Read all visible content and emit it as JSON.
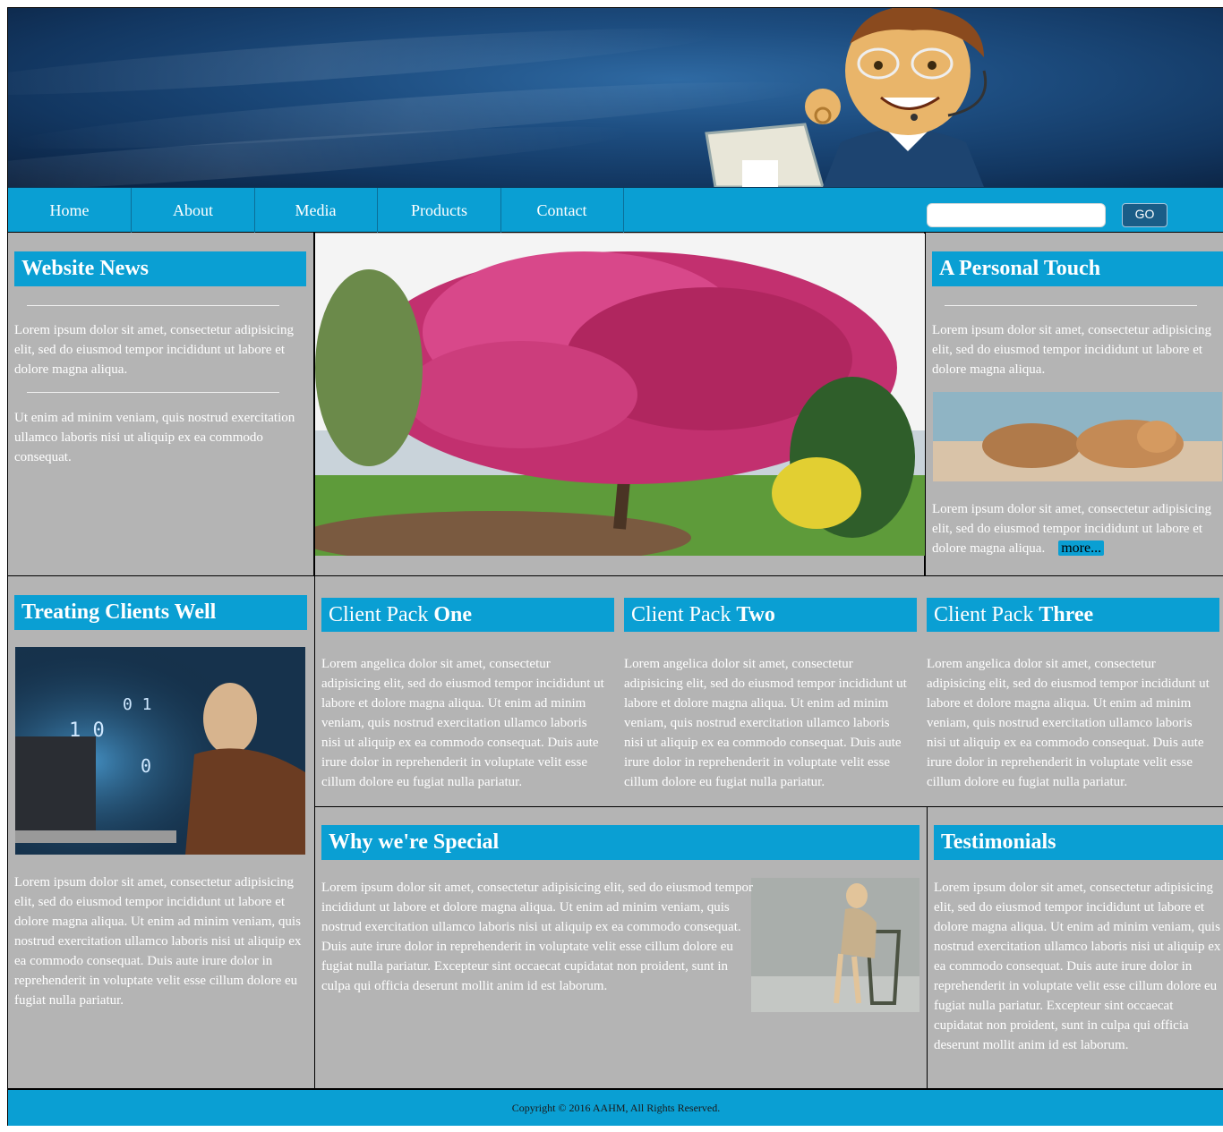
{
  "nav": {
    "items": [
      "Home",
      "About",
      "Media",
      "Products",
      "Contact"
    ],
    "search_placeholder": "",
    "go_label": "GO"
  },
  "website_news": {
    "title": "Website News",
    "para1": "Lorem ipsum dolor sit amet, consectetur adipisicing elit, sed do eiusmod tempor incididunt ut labore et dolore magna aliqua.",
    "para2": "Ut enim ad minim veniam, quis nostrud exercitation ullamco laboris nisi ut aliquip ex ea commodo consequat."
  },
  "personal_touch": {
    "title": "A Personal Touch",
    "para1": "Lorem ipsum dolor sit amet, consectetur adipisicing elit, sed do eiusmod tempor incididunt ut labore et dolore magna aliqua.",
    "para2": "Lorem ipsum dolor sit amet, consectetur adipisicing elit, sed do eiusmod tempor incididunt ut labore et dolore magna aliqua.",
    "more_label": "more..."
  },
  "treating_clients": {
    "title": "Treating Clients Well",
    "para": "Lorem ipsum dolor sit amet, consectetur adipisicing elit, sed do eiusmod tempor incididunt ut labore et dolore magna aliqua. Ut enim ad minim veniam, quis nostrud exercitation ullamco laboris nisi ut aliquip ex ea commodo consequat. Duis aute irure dolor in reprehenderit in voluptate velit esse cillum dolore eu fugiat nulla pariatur."
  },
  "packs": [
    {
      "prefix": "Client Pack ",
      "bold": "One",
      "text": "Lorem angelica dolor sit amet, consectetur adipisicing elit, sed do eiusmod tempor incididunt ut labore et dolore magna aliqua. Ut enim ad minim veniam, quis nostrud exercitation ullamco laboris nisi ut aliquip ex ea commodo consequat. Duis aute irure dolor in reprehenderit in voluptate velit esse cillum dolore eu fugiat nulla pariatur."
    },
    {
      "prefix": "Client Pack ",
      "bold": "Two",
      "text": "Lorem angelica dolor sit amet, consectetur adipisicing elit, sed do eiusmod tempor incididunt ut labore et dolore magna aliqua. Ut enim ad minim veniam, quis nostrud exercitation ullamco laboris nisi ut aliquip ex ea commodo consequat. Duis aute irure dolor in reprehenderit in voluptate velit esse cillum dolore eu fugiat nulla pariatur."
    },
    {
      "prefix": "Client Pack ",
      "bold": "Three",
      "text": "Lorem angelica dolor sit amet, consectetur adipisicing elit, sed do eiusmod tempor incididunt ut labore et dolore magna aliqua. Ut enim ad minim veniam, quis nostrud exercitation ullamco laboris nisi ut aliquip ex ea commodo consequat. Duis aute irure dolor in reprehenderit in voluptate velit esse cillum dolore eu fugiat nulla pariatur."
    }
  ],
  "special": {
    "title": "Why we're Special",
    "para": "Lorem ipsum dolor sit amet, consectetur adipisicing elit, sed do eiusmod tempor incididunt ut labore et dolore magna aliqua. Ut enim ad minim veniam, quis nostrud exercitation ullamco laboris nisi ut aliquip ex ea commodo consequat. Duis aute irure dolor in reprehenderit in voluptate velit esse cillum dolore eu fugiat nulla pariatur. Excepteur sint occaecat cupidatat non proident, sunt in culpa qui officia deserunt mollit anim id est laborum."
  },
  "testimonials": {
    "title": "Testimonials",
    "para": "Lorem ipsum dolor sit amet, consectetur adipisicing elit, sed do eiusmod tempor incididunt ut labore et dolore magna aliqua. Ut enim ad minim veniam, quis nostrud exercitation ullamco laboris nisi ut aliquip ex ea commodo consequat. Duis aute irure dolor in reprehenderit in voluptate velit esse cillum dolore eu fugiat nulla pariatur. Excepteur sint occaecat cupidatat non proident, sunt in culpa qui officia deserunt mollit anim id est laborum."
  },
  "footer": {
    "copyright": "Copyright © 2016 AAHM, All Rights Reserved."
  },
  "colors": {
    "accent": "#0a9fd3",
    "panel_bg": "#b4b4b4",
    "banner_dark": "#123660"
  }
}
